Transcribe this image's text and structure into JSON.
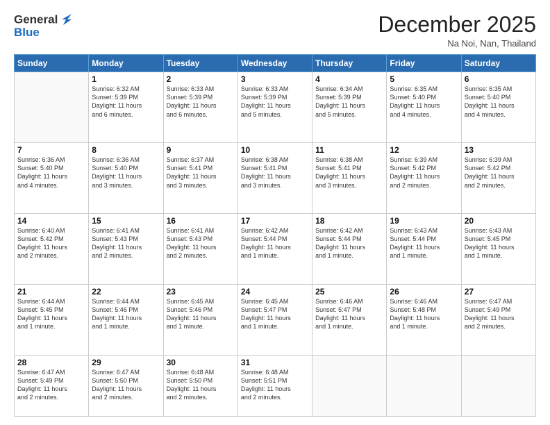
{
  "header": {
    "logo_line1": "General",
    "logo_line2": "Blue",
    "month": "December 2025",
    "location": "Na Noi, Nan, Thailand"
  },
  "weekdays": [
    "Sunday",
    "Monday",
    "Tuesday",
    "Wednesday",
    "Thursday",
    "Friday",
    "Saturday"
  ],
  "rows": [
    [
      {
        "day": "",
        "info": ""
      },
      {
        "day": "1",
        "info": "Sunrise: 6:32 AM\nSunset: 5:39 PM\nDaylight: 11 hours\nand 6 minutes."
      },
      {
        "day": "2",
        "info": "Sunrise: 6:33 AM\nSunset: 5:39 PM\nDaylight: 11 hours\nand 6 minutes."
      },
      {
        "day": "3",
        "info": "Sunrise: 6:33 AM\nSunset: 5:39 PM\nDaylight: 11 hours\nand 5 minutes."
      },
      {
        "day": "4",
        "info": "Sunrise: 6:34 AM\nSunset: 5:39 PM\nDaylight: 11 hours\nand 5 minutes."
      },
      {
        "day": "5",
        "info": "Sunrise: 6:35 AM\nSunset: 5:40 PM\nDaylight: 11 hours\nand 4 minutes."
      },
      {
        "day": "6",
        "info": "Sunrise: 6:35 AM\nSunset: 5:40 PM\nDaylight: 11 hours\nand 4 minutes."
      }
    ],
    [
      {
        "day": "7",
        "info": "Sunrise: 6:36 AM\nSunset: 5:40 PM\nDaylight: 11 hours\nand 4 minutes."
      },
      {
        "day": "8",
        "info": "Sunrise: 6:36 AM\nSunset: 5:40 PM\nDaylight: 11 hours\nand 3 minutes."
      },
      {
        "day": "9",
        "info": "Sunrise: 6:37 AM\nSunset: 5:41 PM\nDaylight: 11 hours\nand 3 minutes."
      },
      {
        "day": "10",
        "info": "Sunrise: 6:38 AM\nSunset: 5:41 PM\nDaylight: 11 hours\nand 3 minutes."
      },
      {
        "day": "11",
        "info": "Sunrise: 6:38 AM\nSunset: 5:41 PM\nDaylight: 11 hours\nand 3 minutes."
      },
      {
        "day": "12",
        "info": "Sunrise: 6:39 AM\nSunset: 5:42 PM\nDaylight: 11 hours\nand 2 minutes."
      },
      {
        "day": "13",
        "info": "Sunrise: 6:39 AM\nSunset: 5:42 PM\nDaylight: 11 hours\nand 2 minutes."
      }
    ],
    [
      {
        "day": "14",
        "info": "Sunrise: 6:40 AM\nSunset: 5:42 PM\nDaylight: 11 hours\nand 2 minutes."
      },
      {
        "day": "15",
        "info": "Sunrise: 6:41 AM\nSunset: 5:43 PM\nDaylight: 11 hours\nand 2 minutes."
      },
      {
        "day": "16",
        "info": "Sunrise: 6:41 AM\nSunset: 5:43 PM\nDaylight: 11 hours\nand 2 minutes."
      },
      {
        "day": "17",
        "info": "Sunrise: 6:42 AM\nSunset: 5:44 PM\nDaylight: 11 hours\nand 1 minute."
      },
      {
        "day": "18",
        "info": "Sunrise: 6:42 AM\nSunset: 5:44 PM\nDaylight: 11 hours\nand 1 minute."
      },
      {
        "day": "19",
        "info": "Sunrise: 6:43 AM\nSunset: 5:44 PM\nDaylight: 11 hours\nand 1 minute."
      },
      {
        "day": "20",
        "info": "Sunrise: 6:43 AM\nSunset: 5:45 PM\nDaylight: 11 hours\nand 1 minute."
      }
    ],
    [
      {
        "day": "21",
        "info": "Sunrise: 6:44 AM\nSunset: 5:45 PM\nDaylight: 11 hours\nand 1 minute."
      },
      {
        "day": "22",
        "info": "Sunrise: 6:44 AM\nSunset: 5:46 PM\nDaylight: 11 hours\nand 1 minute."
      },
      {
        "day": "23",
        "info": "Sunrise: 6:45 AM\nSunset: 5:46 PM\nDaylight: 11 hours\nand 1 minute."
      },
      {
        "day": "24",
        "info": "Sunrise: 6:45 AM\nSunset: 5:47 PM\nDaylight: 11 hours\nand 1 minute."
      },
      {
        "day": "25",
        "info": "Sunrise: 6:46 AM\nSunset: 5:47 PM\nDaylight: 11 hours\nand 1 minute."
      },
      {
        "day": "26",
        "info": "Sunrise: 6:46 AM\nSunset: 5:48 PM\nDaylight: 11 hours\nand 1 minute."
      },
      {
        "day": "27",
        "info": "Sunrise: 6:47 AM\nSunset: 5:49 PM\nDaylight: 11 hours\nand 2 minutes."
      }
    ],
    [
      {
        "day": "28",
        "info": "Sunrise: 6:47 AM\nSunset: 5:49 PM\nDaylight: 11 hours\nand 2 minutes."
      },
      {
        "day": "29",
        "info": "Sunrise: 6:47 AM\nSunset: 5:50 PM\nDaylight: 11 hours\nand 2 minutes."
      },
      {
        "day": "30",
        "info": "Sunrise: 6:48 AM\nSunset: 5:50 PM\nDaylight: 11 hours\nand 2 minutes."
      },
      {
        "day": "31",
        "info": "Sunrise: 6:48 AM\nSunset: 5:51 PM\nDaylight: 11 hours\nand 2 minutes."
      },
      {
        "day": "",
        "info": ""
      },
      {
        "day": "",
        "info": ""
      },
      {
        "day": "",
        "info": ""
      }
    ]
  ]
}
